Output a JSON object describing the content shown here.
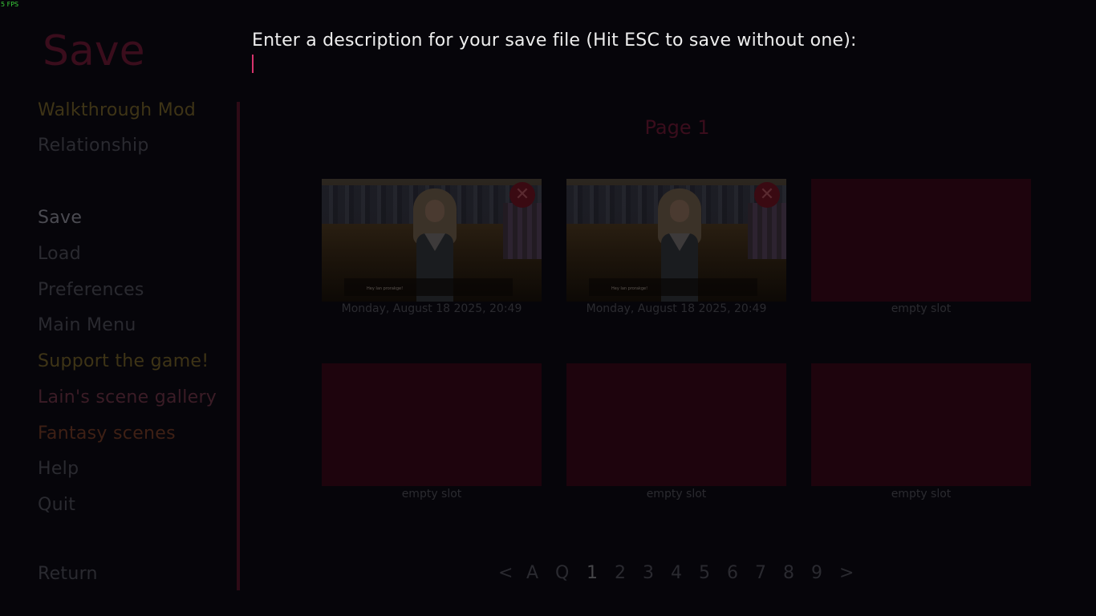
{
  "fps": "5 FPS",
  "screen_title": "Save",
  "prompt": "Enter a description for your save file (Hit ESC to save without one):",
  "input_value": "",
  "menu": {
    "top": [
      "Walkthrough Mod",
      "Relationship"
    ],
    "main": [
      "Save",
      "Load",
      "Preferences",
      "Main Menu",
      "Support the game!",
      "Lain's scene gallery",
      "Fantasy scenes",
      "Help",
      "Quit"
    ],
    "return": "Return"
  },
  "page_title": "Page 1",
  "slots": [
    {
      "label": "Monday, August 18 2025, 20:49",
      "has_screenshot": true,
      "delete_icon": "✕",
      "dialogue": "Hey Ian prorakge!"
    },
    {
      "label": "Monday, August 18 2025, 20:49",
      "has_screenshot": true,
      "delete_icon": "✕",
      "dialogue": "Hey Ian prorakge!"
    },
    {
      "label": "empty slot",
      "has_screenshot": false
    },
    {
      "label": "empty slot",
      "has_screenshot": false
    },
    {
      "label": "empty slot",
      "has_screenshot": false
    },
    {
      "label": "empty slot",
      "has_screenshot": false
    }
  ],
  "pagination": [
    "<",
    "A",
    "Q",
    "1",
    "2",
    "3",
    "4",
    "5",
    "6",
    "7",
    "8",
    "9",
    ">"
  ],
  "current_page": "1",
  "colors": {
    "background": "#06050a",
    "accent": "#d6336c",
    "empty_slot": "#1e040d",
    "prompt_text": "#eeeeee"
  }
}
